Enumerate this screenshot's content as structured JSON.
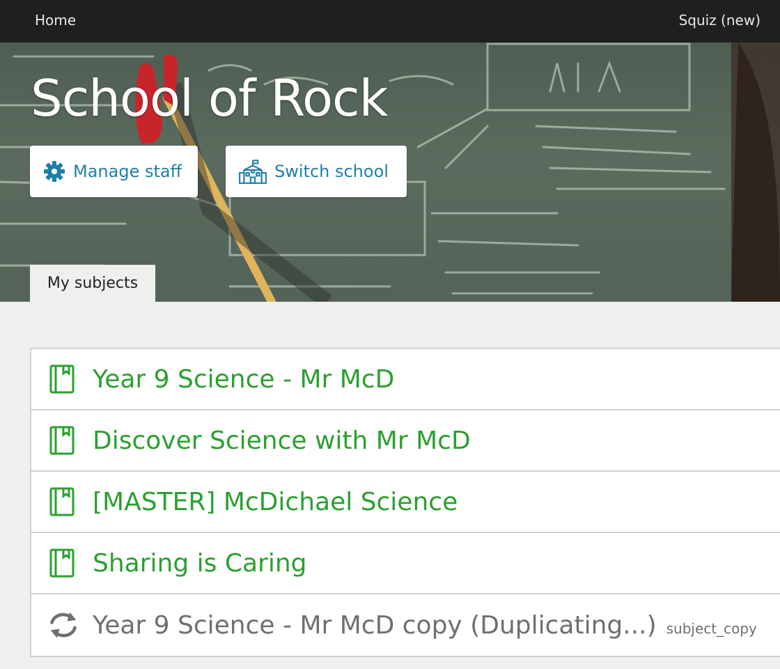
{
  "topbar": {
    "home": "Home",
    "account": "Squiz (new)"
  },
  "hero": {
    "title": "School of Rock",
    "manage_staff": "Manage staff",
    "switch_school": "Switch school",
    "tab": "My subjects"
  },
  "subjects": [
    {
      "label": "Year 9 Science - Mr McD",
      "icon": "book-icon"
    },
    {
      "label": "Discover Science with Mr McD",
      "icon": "book-icon"
    },
    {
      "label": "[MASTER] McDichael Science",
      "icon": "book-icon"
    },
    {
      "label": "Sharing is Caring",
      "icon": "book-icon"
    }
  ],
  "pending": {
    "label": "Year 9 Science - Mr McD copy (Duplicating...)",
    "tag": "subject_copy",
    "icon": "sync-icon"
  },
  "colors": {
    "link_green": "#2aa02f",
    "button_blue": "#1e7fa8",
    "topbar": "#1f1f1f"
  }
}
